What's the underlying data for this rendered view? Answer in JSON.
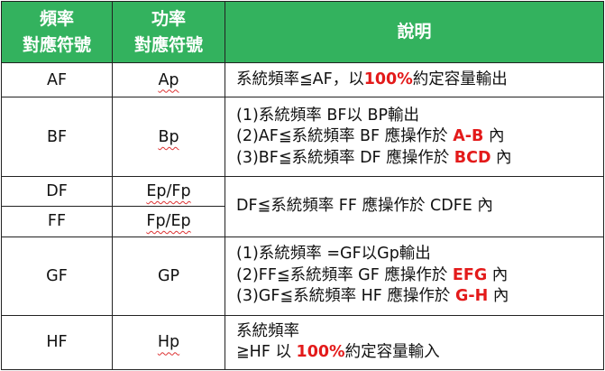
{
  "table": {
    "headers": {
      "freq": [
        "頻率",
        "對應符號"
      ],
      "power": [
        "功率",
        "對應符號"
      ],
      "desc": "說明"
    },
    "rows": [
      {
        "freq": "AF",
        "power": "Ap",
        "lines": [
          [
            "系統頻率≦AF，以",
            "100%",
            "約定容量輸出"
          ]
        ]
      },
      {
        "freq": "BF",
        "power": "Bp",
        "lines": [
          [
            "(1)系統頻率 BF以 BP輸出"
          ],
          [
            "(2)AF≦系統頻率 BF 應操作於 ",
            "A-B",
            " 內"
          ],
          [
            "(3)BF≦系統頻率 DF 應操作於 ",
            "BCD",
            " 內"
          ]
        ]
      },
      {
        "freq": "DF",
        "power": "Ep/Fp"
      },
      {
        "freq": "FF",
        "power": "Fp/Ep"
      },
      {
        "freq": "GF",
        "power": "GP",
        "lines": [
          [
            "(1)系統頻率 =GF以Gp輸出"
          ],
          [
            "(2)FF≦系統頻率 GF 應操作於 ",
            "EFG",
            " 內"
          ],
          [
            "(3)GF≦系統頻率 HF 應操作於 ",
            "G-H",
            " 內"
          ]
        ]
      },
      {
        "freq": "HF",
        "power": "Hp",
        "lines": [
          [
            "系統頻率"
          ],
          [
            "≧HF 以 ",
            "100%",
            "約定容量輸入"
          ]
        ]
      }
    ],
    "merged_desc": "DF≦系統頻率 FF 應操作於 CDFE 內"
  }
}
